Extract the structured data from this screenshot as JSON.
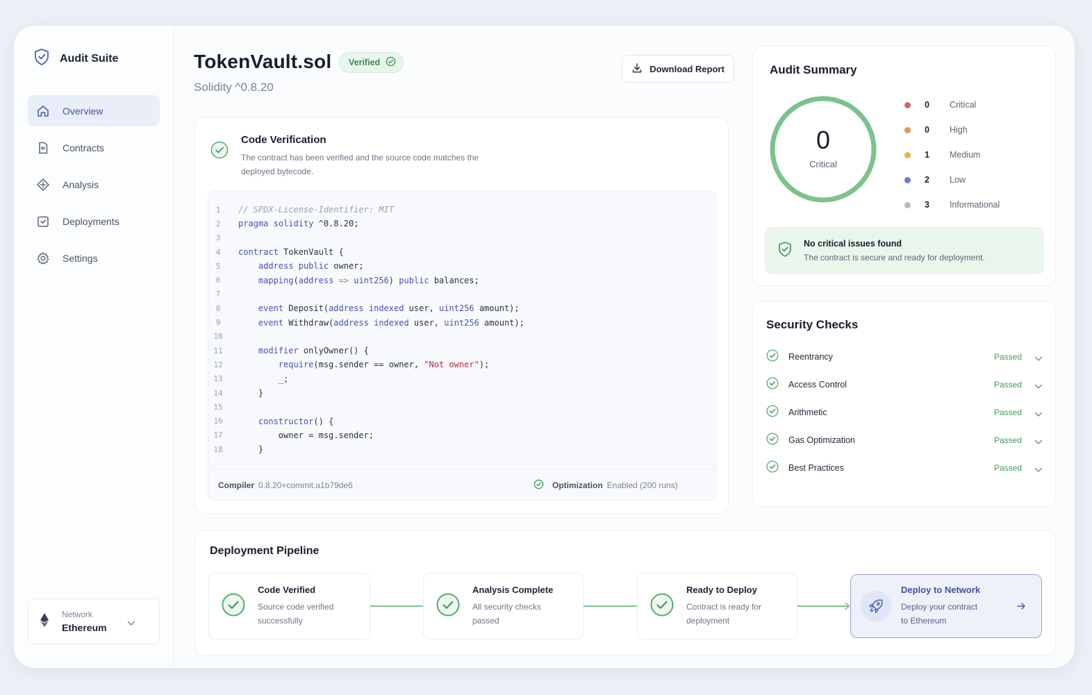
{
  "brand": {
    "name": "Audit Suite",
    "icon": "shield-icon"
  },
  "sidebar": {
    "items": [
      {
        "label": "Overview",
        "icon": "home-icon",
        "active": true
      },
      {
        "label": "Contracts",
        "icon": "file-icon"
      },
      {
        "label": "Analysis",
        "icon": "analysis-icon"
      },
      {
        "label": "Deployments",
        "icon": "deploy-icon"
      },
      {
        "label": "Settings",
        "icon": "gear-icon"
      }
    ],
    "network": {
      "label": "Network",
      "value": "Ethereum",
      "icon": "ethereum-icon"
    }
  },
  "header": {
    "title": "TokenVault.sol",
    "badge": "Verified",
    "subtitle": "Solidity ^0.8.20",
    "download_label": "Download Report"
  },
  "verification": {
    "title": "Code Verification",
    "description": "The contract has been verified and the source code matches the deployed bytecode.",
    "code_lines": [
      "// SPDX-License-Identifier: MIT",
      "pragma solidity ^0.8.20;",
      "",
      "contract TokenVault {",
      "    address public owner;",
      "    mapping(address => uint256) public balances;",
      "",
      "    event Deposit(address indexed user, uint256 amount);",
      "    event Withdraw(address indexed user, uint256 amount);",
      "",
      "    modifier onlyOwner() {",
      "        require(msg.sender == owner, \"Not owner\");",
      "        _;",
      "    }",
      "",
      "    constructor() {",
      "        owner = msg.sender;",
      "    }"
    ],
    "footer": {
      "compiler_label": "Compiler",
      "compiler_value": "0.8.20+commit.a1b79de6",
      "optimization_label": "Optimization",
      "optimization_value": "Enabled (200 runs)"
    }
  },
  "summary": {
    "title": "Audit Summary",
    "ring_value": "0",
    "ring_label": "Critical",
    "severities": [
      {
        "count": "0",
        "name": "Critical",
        "color": "#d0646a"
      },
      {
        "count": "0",
        "name": "High",
        "color": "#e8935a"
      },
      {
        "count": "1",
        "name": "Medium",
        "color": "#ecb04e"
      },
      {
        "count": "2",
        "name": "Low",
        "color": "#6f79d6"
      },
      {
        "count": "3",
        "name": "Informational",
        "color": "#b3b9c6"
      }
    ],
    "banner_title": "No critical issues found",
    "banner_desc": "The contract is secure and ready for deployment."
  },
  "checks": {
    "title": "Security Checks",
    "items": [
      {
        "name": "Reentrancy",
        "status": "Passed"
      },
      {
        "name": "Access Control",
        "status": "Passed"
      },
      {
        "name": "Arithmetic",
        "status": "Passed"
      },
      {
        "name": "Gas Optimization",
        "status": "Passed"
      },
      {
        "name": "Best Practices",
        "status": "Passed"
      }
    ]
  },
  "pipeline": {
    "title": "Deployment Pipeline",
    "steps": [
      {
        "title": "Code Verified",
        "desc1": "Source code verified",
        "desc2": "successfully"
      },
      {
        "title": "Analysis Complete",
        "desc1": "All security checks",
        "desc2": "passed"
      },
      {
        "title": "Ready to Deploy",
        "desc1": "Contract is ready for",
        "desc2": "deployment"
      },
      {
        "title": "Deploy to Network",
        "desc1": "Deploy your contract",
        "desc2": "to Ethereum"
      }
    ]
  },
  "colors": {
    "accent": "#4052a6",
    "success": "#3f9a5e",
    "ring": "#7cc28e"
  }
}
